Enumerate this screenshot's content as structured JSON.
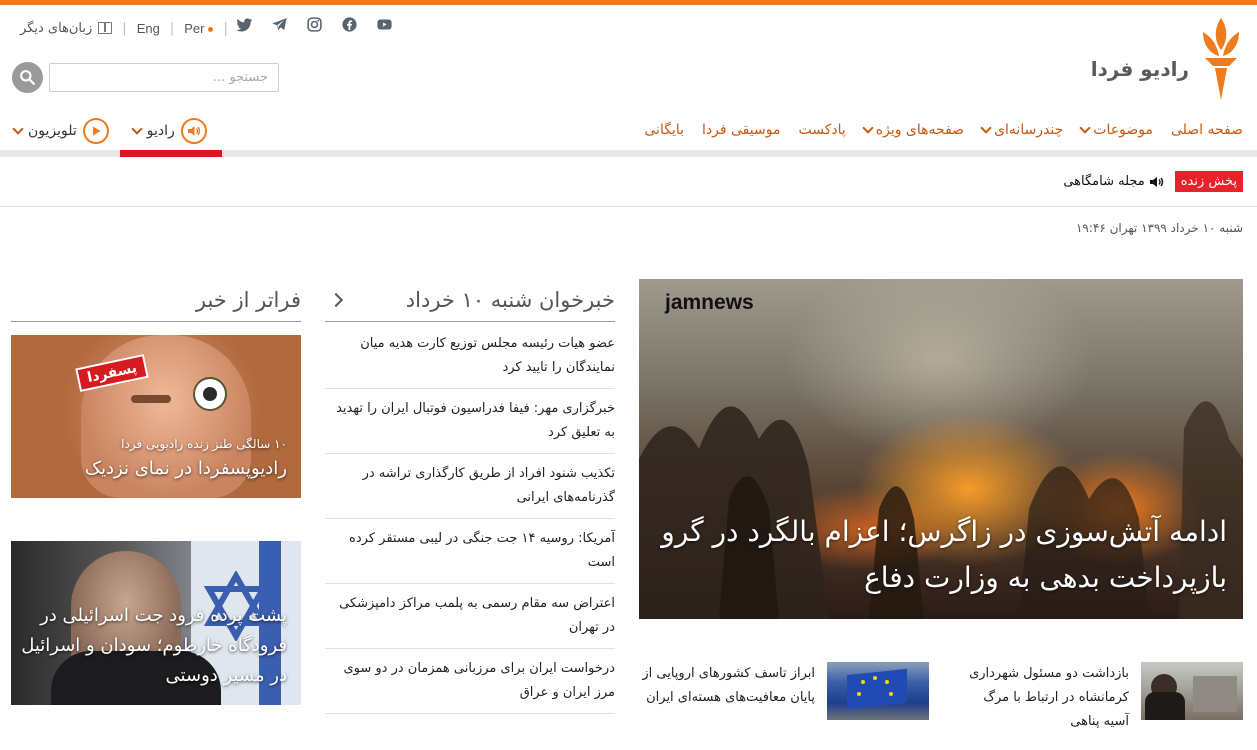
{
  "header": {
    "other_languages": "زبان‌های دیگر",
    "lang_eng": "Eng",
    "lang_per": "Per",
    "social_icons": [
      "twitter-icon",
      "telegram-icon",
      "instagram-icon",
      "facebook-icon",
      "youtube-icon"
    ],
    "logo_text": "رادیو فردا",
    "search_placeholder": "جستجو ..."
  },
  "nav": {
    "items": [
      {
        "label": "صفحه اصلی",
        "has_dropdown": false
      },
      {
        "label": "موضوعات",
        "has_dropdown": true
      },
      {
        "label": "چندرسانه‌ای",
        "has_dropdown": true
      },
      {
        "label": "صفحه‌های ویژه",
        "has_dropdown": true
      },
      {
        "label": "پادکست",
        "has_dropdown": false
      },
      {
        "label": "موسیقی فردا",
        "has_dropdown": false
      },
      {
        "label": "بایگانی",
        "has_dropdown": false
      }
    ],
    "radio_label": "رادیو",
    "tv_label": "تلویزیون"
  },
  "live": {
    "badge": "پخش زنده",
    "title": "مجله شامگاهی"
  },
  "date_line": "شنبه ۱۰ خرداد ۱۳۹۹ تهران ۱۹:۴۶",
  "hero": {
    "watermark": "jamnews",
    "title": "ادامه آتش‌سوزی در زاگرس؛ اعزام بالگرد در گرو بازپرداخت بدهی به وزارت دفاع"
  },
  "small_stories": [
    {
      "text": "بازداشت دو مسئول شهرداری کرمانشاه در ارتباط با مرگ آسیه پناهی"
    },
    {
      "text": "ابراز تاسف کشورهای اروپایی از پایان معافیت‌های هسته‌ای ایران"
    }
  ],
  "news_feed": {
    "heading": "خبرخوان شنبه ۱۰ خرداد",
    "items": [
      "عضو هیات رئیسه مجلس توزیع کارت هدیه میان نمایندگان را تایید کرد",
      "خبرگزاری مهر: فیفا فدراسیون فوتبال ایران را تهدید به تعلیق کرد",
      "تکذیب شنود افراد از طریق کارگذاری تراشه در گذرنامه‌های ایرانی",
      "آمریکا: روسیه ۱۴ جت جنگی در لیبی مستقر کرده است",
      "اعتراض سه مقام رسمی به پلمب مراکز دامپزشکی در تهران",
      "درخواست ایران برای مرزبانی همزمان در دو سوی مرز ایران و عراق"
    ]
  },
  "beyond_news": {
    "heading": "فراتر از خبر",
    "cards": [
      {
        "kicker": "۱۰ سالگی طنز زنده رادیویی فردا",
        "title": "رادیوپسفردا در نمای نزدیک",
        "stamp": "پسفردا"
      },
      {
        "kicker": "",
        "title": "پشت پرده فرود جت اسرائیلی در فرودگاه خارطوم؛ سودان و اسرائیل در مسیر دوستی"
      }
    ]
  },
  "colors": {
    "accent": "#f07b1d",
    "nav_text": "#c55a11",
    "live_red": "#e8222a",
    "radio_underline": "#d71920"
  }
}
